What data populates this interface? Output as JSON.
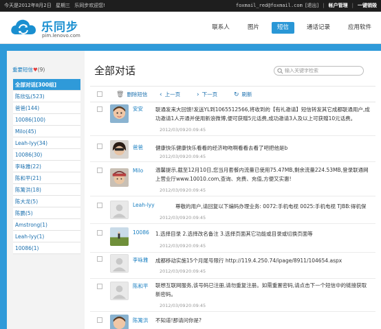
{
  "topbar": {
    "left": [
      "今天是2012年8月2日",
      "星期三",
      "乐同步欢迎您!"
    ],
    "email": "foxmail_red@foxmail.com",
    "logout_short": "[退出]",
    "account": "帐户管理",
    "logout": "一键销毁"
  },
  "header": {
    "logo_text": "乐同步",
    "logo_sub": "pim.lenovo.com",
    "nav": [
      "联系人",
      "图片",
      "短信",
      "通话记录",
      "应用软件"
    ],
    "active_nav": 2,
    "brand_color": "#2f9ad9"
  },
  "sidebar": {
    "favorites_label": "重要短信",
    "favorites_count": "(9)",
    "items": [
      "全部对话[300组]",
      "陈欣弘(523)",
      "爸爸(144)",
      "10086(100)",
      "Milo(45)",
      "Leah-lyy(34)",
      "10086(30)",
      "李咏雅(22)",
      "陈和平(21)",
      "陈篱洪(18)",
      "陈大龙(5)",
      "陈鹏(5)",
      "Amstrong(1)",
      "Leah-lyy(1)",
      "10086(1)"
    ]
  },
  "main": {
    "title": "全部对话",
    "search_placeholder": "输入关键字检索",
    "toolbar": {
      "delete": "删除短信",
      "prev": "上一页",
      "next": "下一页",
      "refresh": "刷新"
    },
    "messages": [
      {
        "sender": "安安",
        "text": "联通发来大回馈!发送YL到1065512566,将收到的【有礼邀请】短信转发其它成都联通用户,成功邀请1人开通并使用新浪微博,便可获赠5元话费,成功邀请3人及以上可获赠10元话费。",
        "time": "2012/03/09",
        "clock": "20:09:45"
      },
      {
        "sender": "爸爸",
        "text": "健康快乐健康快乐看看的经济吻吻啊看看去看了吧把他是b",
        "time": "2012/03/09",
        "clock": "20:09:45"
      },
      {
        "sender": "Milo",
        "text": "温馨提示,截至12月10日,您当月套餐内流量已使用75.47MB,剩余流量224.53MB,登录联通网上营业厅www.10010.com,查询、充费、充值,方便又实惠!",
        "time": "2012/03/09",
        "clock": "20:09:45"
      },
      {
        "sender": "Leah-lyy",
        "text": "尊敬的用户,请回复以下编码办理业务: 0072:手机电视 0025:手机电视 TJBB:得机保",
        "time": "2012/03/09",
        "clock": "20:09:45"
      },
      {
        "sender": "10086",
        "text": "1.选择目录 2.选择改名备注 3.选择页面其它功能或目录或切换页面等",
        "time": "2012/03/09",
        "clock": "20:09:45"
      },
      {
        "sender": "李咏雅",
        "text": "成都移动实施15个月尾号限行 http://119.4.250.74/ipage/8911/104654.aspx",
        "time": "2012/03/09",
        "clock": "20:09:45"
      },
      {
        "sender": "陈和平",
        "text": "联想互联网服务,该号码已注册,请勿重复注册。如需重置密码,请点击下一个短信中的链接获取新密码。",
        "time": "2012/03/09",
        "clock": "20:09:45"
      },
      {
        "sender": "陈篱洪",
        "text": "不知道!那请问你是?",
        "time": "",
        "clock": ""
      }
    ]
  }
}
